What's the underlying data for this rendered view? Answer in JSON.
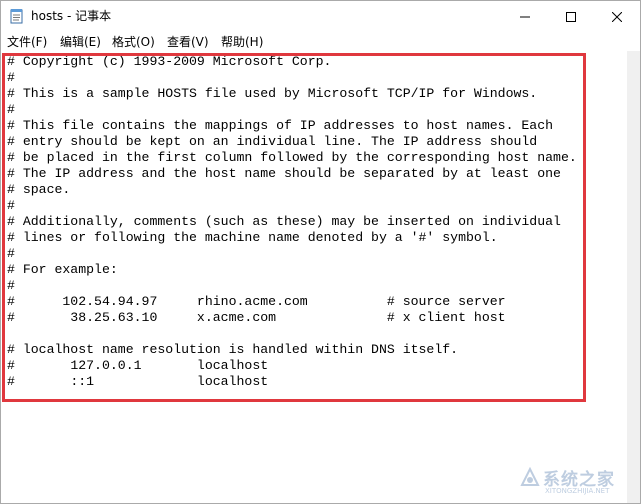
{
  "window": {
    "title": "hosts - 记事本"
  },
  "menu": {
    "items": [
      {
        "label": "文件(F)"
      },
      {
        "label": "编辑(E)"
      },
      {
        "label": "格式(O)"
      },
      {
        "label": "查看(V)"
      },
      {
        "label": "帮助(H)"
      }
    ]
  },
  "editor": {
    "content": "# Copyright (c) 1993-2009 Microsoft Corp.\n#\n# This is a sample HOSTS file used by Microsoft TCP/IP for Windows.\n#\n# This file contains the mappings of IP addresses to host names. Each\n# entry should be kept on an individual line. The IP address should\n# be placed in the first column followed by the corresponding host name.\n# The IP address and the host name should be separated by at least one\n# space.\n#\n# Additionally, comments (such as these) may be inserted on individual\n# lines or following the machine name denoted by a '#' symbol.\n#\n# For example:\n#\n#      102.54.94.97     rhino.acme.com          # source server\n#       38.25.63.10     x.acme.com              # x client host\n\n# localhost name resolution is handled within DNS itself.\n#\t127.0.0.1       localhost\n#\t::1             localhost",
    "highlight_color": "#e0383e"
  },
  "watermark": {
    "text": "系统之家",
    "subtext": "XITONGZHIJIA.NET"
  },
  "icons": {
    "app": "notepad-icon",
    "minimize": "minimize-icon",
    "maximize": "maximize-icon",
    "close": "close-icon"
  }
}
